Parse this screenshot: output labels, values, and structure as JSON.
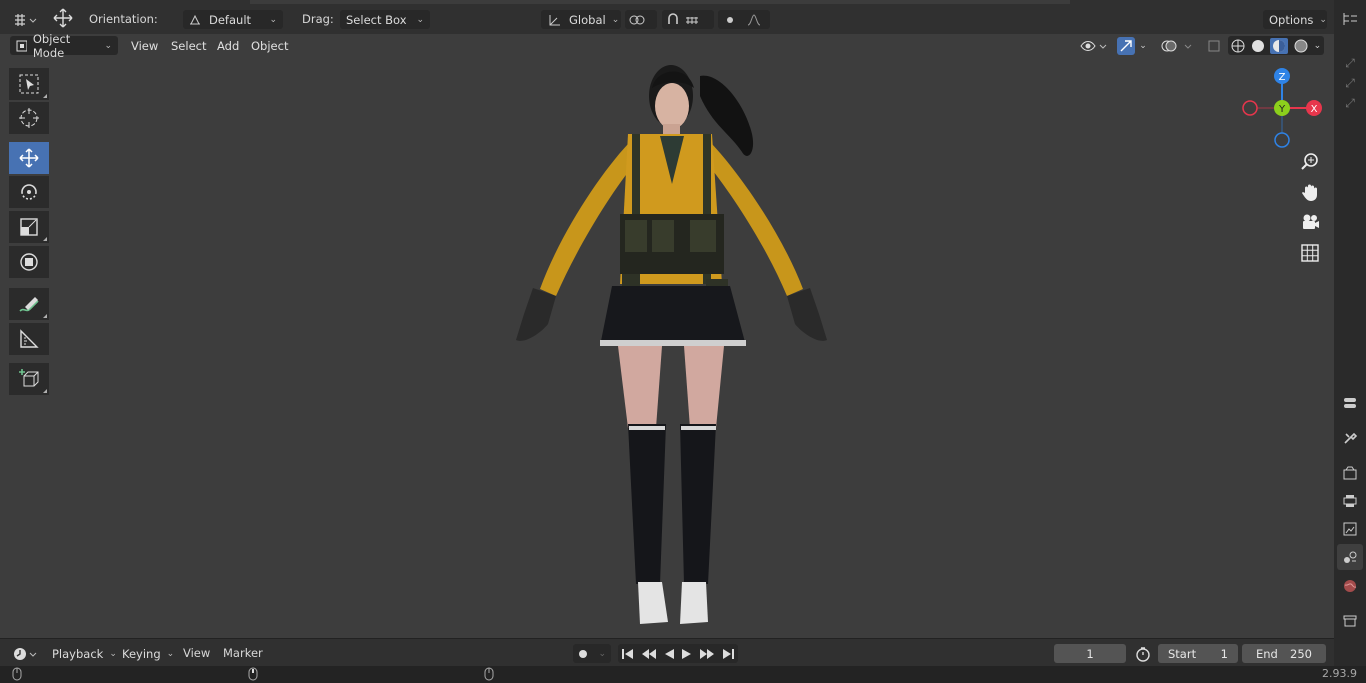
{
  "header": {
    "orientation_label": "Orientation:",
    "orientation_value": "Default",
    "drag_label": "Drag:",
    "drag_value": "Select Box",
    "transform_space": "Global",
    "options_label": "Options"
  },
  "viewport_header": {
    "mode": "Object Mode",
    "menus": [
      "View",
      "Select",
      "Add",
      "Object"
    ]
  },
  "tools": [
    {
      "icon": "select-box-icon",
      "active": false
    },
    {
      "icon": "cursor-icon",
      "active": false
    },
    {
      "icon": "move-icon",
      "active": true
    },
    {
      "icon": "rotate-icon",
      "active": false
    },
    {
      "icon": "scale-icon",
      "active": false
    },
    {
      "icon": "transform-icon",
      "active": false
    },
    {
      "icon": "annotate-icon",
      "active": false
    },
    {
      "icon": "measure-icon",
      "active": false
    },
    {
      "icon": "add-cube-icon",
      "active": false
    }
  ],
  "gizmo": {
    "z": "Z",
    "y": "Y",
    "x": "X",
    "colors": {
      "x": "#e7364c",
      "y": "#8ccf1c",
      "z": "#2f83e6"
    }
  },
  "timeline": {
    "menus": [
      "Playback",
      "Keying",
      "View",
      "Marker"
    ],
    "current_frame": "1",
    "start_label": "Start",
    "start_value": "1",
    "end_label": "End",
    "end_value": "250"
  },
  "status": {
    "version": "2.93.9"
  },
  "colors": {
    "accent": "#4772b3",
    "viewport": "#3d3d3d",
    "header": "#303030"
  }
}
